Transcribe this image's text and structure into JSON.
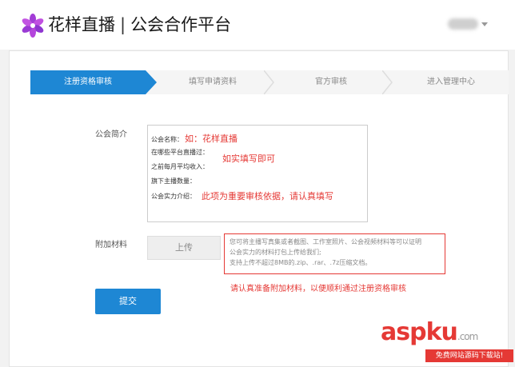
{
  "header": {
    "brand_name": "花样直播",
    "separator": "|",
    "platform_name": "公会合作平台"
  },
  "steps": [
    {
      "label": "注册资格审核",
      "active": true
    },
    {
      "label": "填写申请资料",
      "active": false
    },
    {
      "label": "官方审核",
      "active": false
    },
    {
      "label": "进入管理中心",
      "active": false
    }
  ],
  "form": {
    "intro_label": "公会简介",
    "intro_lines": {
      "name_label": "公会名称：",
      "name_example": "如：花样直播",
      "platforms_label": "在哪些平台直播过：",
      "income_label": "之前每月平均收入：",
      "anchors_label": "旗下主播数量：",
      "strength_label": "公会实力介绍："
    },
    "hint_fill": "如实填写即可",
    "hint_important": "此项为重要审核依据，请认真填写",
    "attachment_label": "附加材料",
    "upload_label": "上传",
    "attachment_note_1": "您可将主播写真集或者截图、工作室照片、公会视频材料等可以证明",
    "attachment_note_2": "公会实力的材料打包上传给我们;",
    "attachment_note_3": "支持上传不超过8MB的.zip、.rar、.7z压缩文档。",
    "attachment_hint": "请认真准备附加材料，以便顺利通过注册资格审核",
    "submit_label": "提交"
  },
  "watermark": {
    "text": "aspku",
    "domain": ".com",
    "tagline": "免费网站源码下载站!"
  },
  "colors": {
    "accent": "#1e87d4",
    "hint_red": "#e53935"
  }
}
